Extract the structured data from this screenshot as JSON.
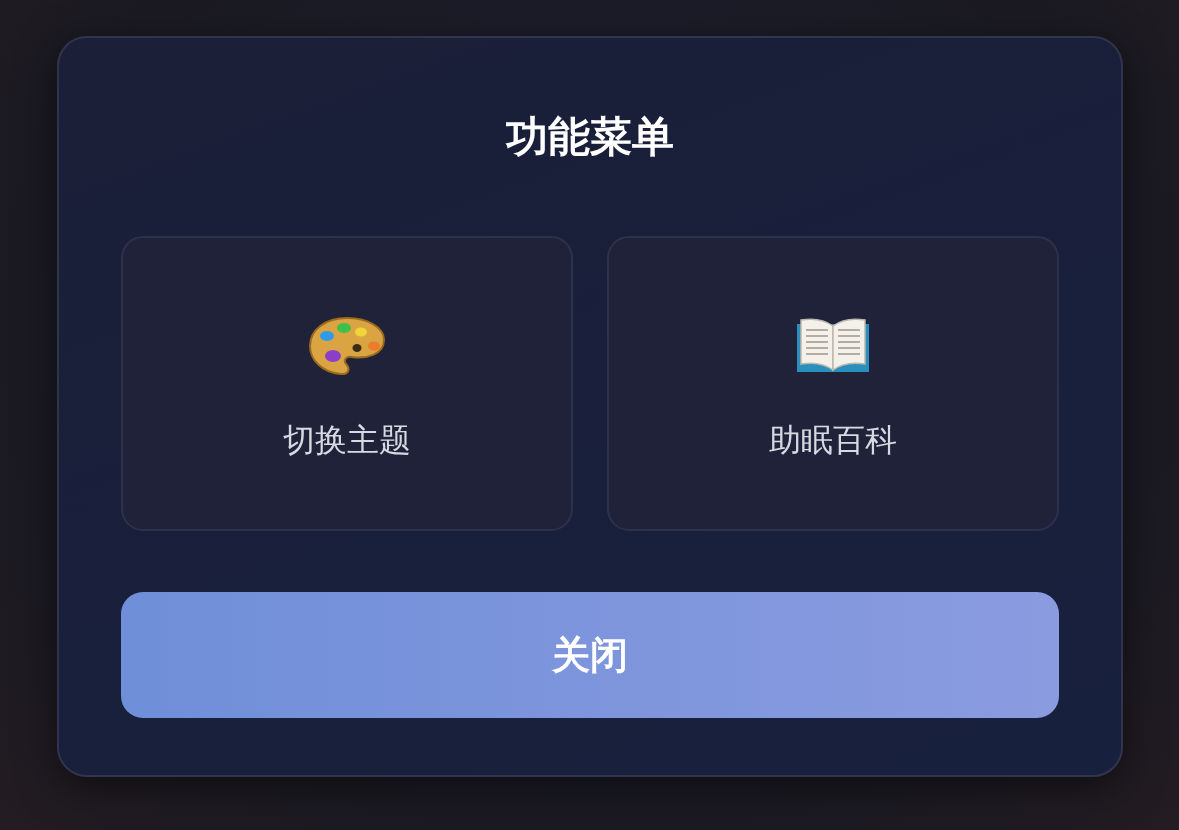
{
  "dialog": {
    "title": "功能菜单",
    "items": [
      {
        "kind": "palette",
        "label": "切换主题"
      },
      {
        "kind": "book",
        "label": "助眠百科"
      }
    ],
    "close_button": "关闭"
  }
}
